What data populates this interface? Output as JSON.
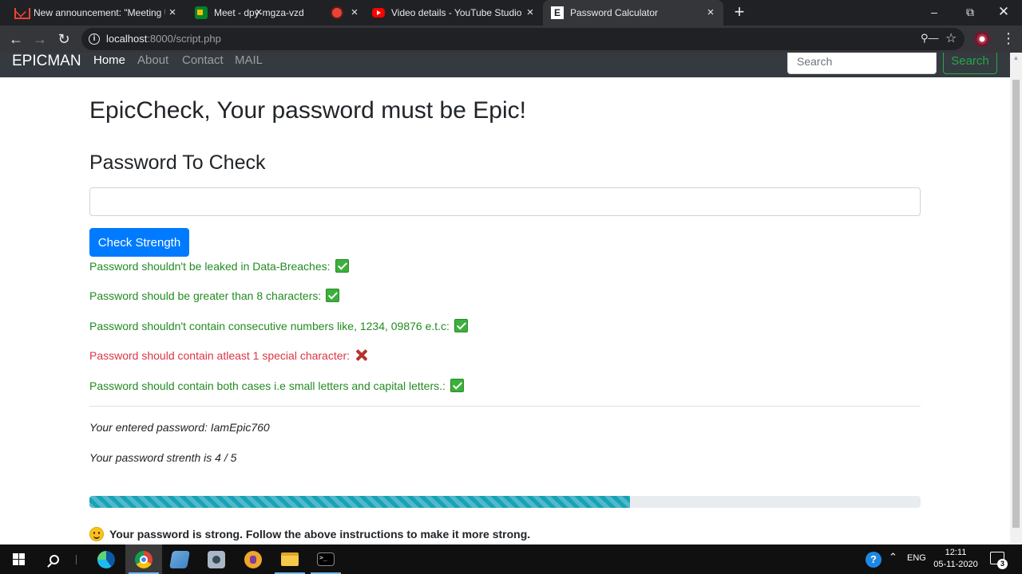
{
  "browser": {
    "tabs": [
      {
        "title": "New announcement: \"Meeting U",
        "icon": "gmail-icon"
      },
      {
        "title": "Meet - dpy-mgza-vzd",
        "icon": "meet-icon"
      },
      {
        "title": "",
        "icon": "recording-icon"
      },
      {
        "title": "Video details - YouTube Studio",
        "icon": "youtube-icon"
      },
      {
        "title": "Password Calculator",
        "icon": "epic-icon"
      }
    ],
    "active_tab": 4,
    "new_tab_label": "+",
    "close_label": "×",
    "url_host": "localhost",
    "url_rest": ":8000/script.php"
  },
  "navbar": {
    "brand": "EPICMAN",
    "links": [
      "Home",
      "About",
      "Contact",
      "MAIL"
    ],
    "active_link": "Home",
    "search_placeholder": "Search",
    "search_button": "Search"
  },
  "main": {
    "title": "EpicCheck, Your password must be Epic!",
    "section_title": "Password To Check",
    "password_value": "",
    "check_button": "Check Strength",
    "rules": [
      {
        "text": "Password shouldn't be leaked in Data-Breaches:",
        "passed": true
      },
      {
        "text": "Password should be greater than 8 characters:",
        "passed": true
      },
      {
        "text": "Password shouldn't contain consecutive numbers like, 1234, 09876 e.t.c:",
        "passed": true
      },
      {
        "text": "Password should contain atleast 1 special character:",
        "passed": false
      },
      {
        "text": "Password should contain both cases i.e small letters and capital letters.:",
        "passed": true
      }
    ],
    "entered_password": "Your entered password: IamEpic760",
    "strength_text": "Your password strenth is 4 / 5",
    "strength_fraction": 0.65,
    "verdict": "Your password is strong. Follow the above instructions to make it more strong."
  },
  "colors": {
    "pass": "#228b22",
    "fail": "#dc3545",
    "primary": "#007bff",
    "progress": "#17a2b8"
  },
  "taskbar": {
    "language": "ENG",
    "time": "12:11",
    "date": "05-11-2020",
    "notification_count": "3"
  }
}
